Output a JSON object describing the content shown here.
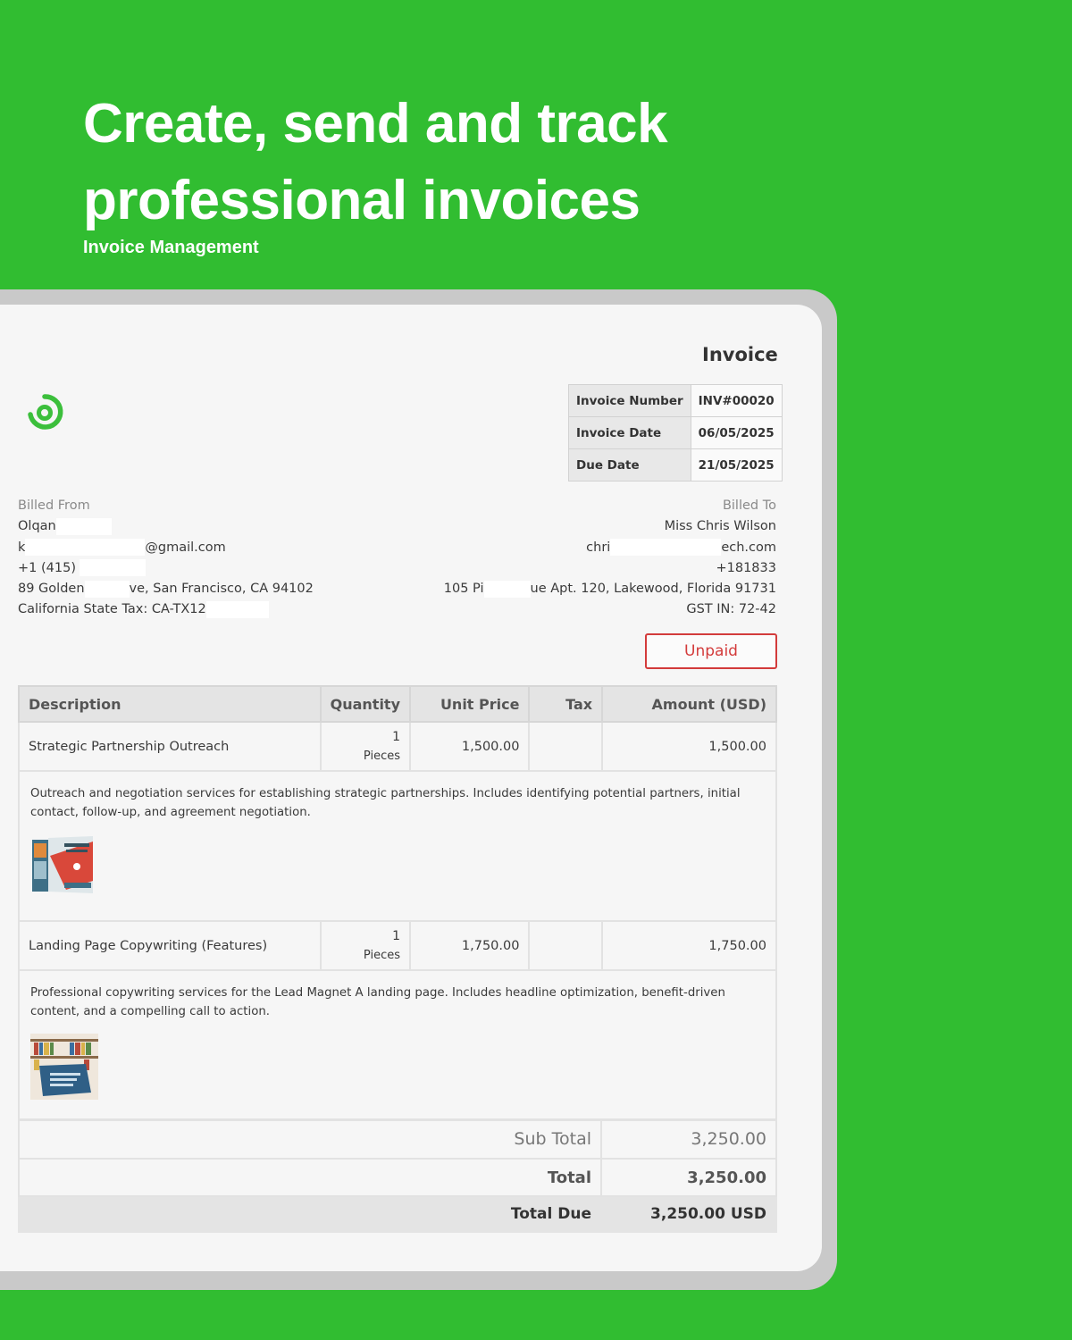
{
  "hero": {
    "title": "Create, send and track professional invoices",
    "subtitle": "Invoice Management"
  },
  "invoice": {
    "heading": "Invoice",
    "meta": [
      {
        "label": "Invoice Number",
        "value": "INV#00020"
      },
      {
        "label": "Invoice Date",
        "value": "06/05/2025"
      },
      {
        "label": "Due Date",
        "value": "21/05/2025"
      }
    ],
    "billed_from": {
      "label": "Billed From",
      "name": "Olqan",
      "email_start": "k",
      "email_end": "@gmail.com",
      "phone": "+1 (415)",
      "address_start": "89 Golden",
      "address_end": "ve, San Francisco, CA 94102",
      "tax": "California State Tax: CA-TX12"
    },
    "billed_to": {
      "label": "Billed To",
      "name": "Miss Chris Wilson",
      "email_start": "chri",
      "email_end": "ech.com",
      "phone": "+181833",
      "address_start": "105 Pi",
      "address_end": "ue Apt. 120, Lakewood, Florida 91731",
      "tax": "GST IN: 72-42"
    },
    "status": "Unpaid",
    "columns": [
      "Description",
      "Quantity",
      "Unit Price",
      "Tax",
      "Amount (USD)"
    ],
    "items": [
      {
        "name": "Strategic Partnership Outreach",
        "qty": "1",
        "unit": "Pieces",
        "price": "1,500.00",
        "tax": "",
        "amount": "1,500.00",
        "description": "Outreach and negotiation services for establishing strategic partnerships. Includes identifying potential partners, initial contact, follow-up, and agreement negotiation."
      },
      {
        "name": "Landing Page Copywriting (Features)",
        "qty": "1",
        "unit": "Pieces",
        "price": "1,750.00",
        "tax": "",
        "amount": "1,750.00",
        "description": "Professional copywriting services for the Lead Magnet A landing page. Includes headline optimization, benefit-driven content, and a compelling call to action."
      }
    ],
    "totals": {
      "sub_total_label": "Sub Total",
      "sub_total": "3,250.00",
      "total_label": "Total",
      "total": "3,250.00",
      "due_label": "Total Due",
      "due": "3,250.00 USD"
    }
  },
  "colors": {
    "background": "#31bd31",
    "status": "#d33b3b",
    "logo": "#3cbf3c"
  }
}
